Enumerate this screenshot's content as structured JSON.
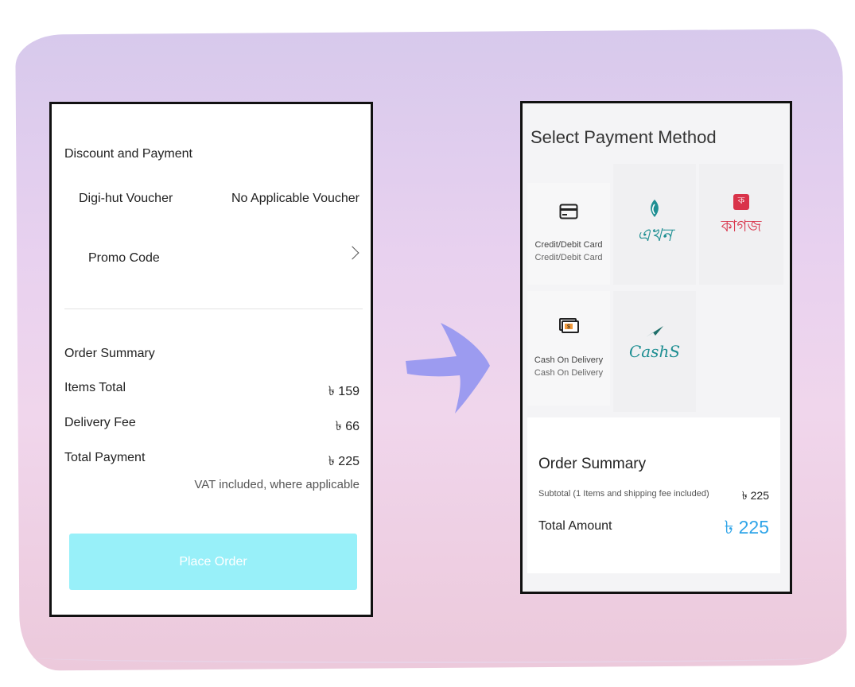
{
  "left_screen": {
    "discount_section_title": "Discount and Payment",
    "voucher_label": "Digi-hut Voucher",
    "voucher_value": "No Applicable Voucher",
    "promo_label": "Promo Code",
    "order_summary_title": "Order Summary",
    "items_total_label": "Items Total",
    "items_total_value": "৳ 159",
    "delivery_fee_label": "Delivery Fee",
    "delivery_fee_value": "৳ 66",
    "total_payment_label": "Total Payment",
    "total_payment_value": "৳ 225",
    "vat_note": "VAT included, where applicable",
    "place_order_label": "Place Order"
  },
  "right_screen": {
    "title": "Select Payment Method",
    "methods": [
      {
        "label": "Credit/Debit Card",
        "sublabel": "Credit/Debit Card",
        "icon": "credit-card-icon"
      },
      {
        "label": "এখন",
        "icon": "ekhon-logo"
      },
      {
        "label": "কাগজ",
        "badge": "ক",
        "icon": "kagoj-logo"
      },
      {
        "label": "Cash On Delivery",
        "sublabel": "Cash On Delivery",
        "icon": "cash-icon"
      },
      {
        "label": "CashS",
        "icon": "cashs-logo"
      }
    ],
    "order_summary_title": "Order Summary",
    "subtotal_label": "Subtotal (1 Items and shipping fee included)",
    "subtotal_value": "৳ 225",
    "total_amount_label": "Total Amount",
    "total_amount_value": "৳ 225"
  },
  "colors": {
    "place_order_bg": "#98f0f9",
    "total_amount_accent": "#2ea4e8",
    "arrow": "#9c9bf0",
    "kagoj_red": "#d9334a",
    "ekhon_teal": "#1f8f93"
  }
}
